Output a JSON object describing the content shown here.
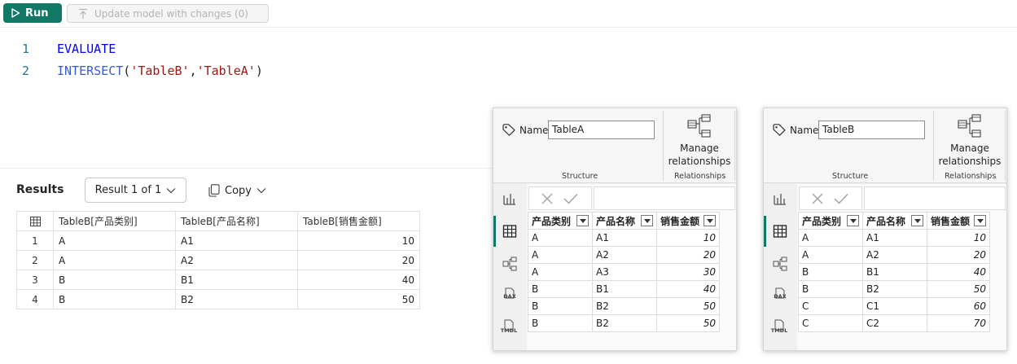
{
  "toolbar": {
    "run_label": "Run",
    "update_label": "Update model with changes (0)"
  },
  "editor": {
    "lines": [
      {
        "number": "1",
        "tokens": [
          {
            "t": "EVALUATE",
            "c": "kw"
          }
        ]
      },
      {
        "number": "2",
        "tokens": [
          {
            "t": "INTERSECT",
            "c": "fn"
          },
          {
            "t": "(",
            "c": "punc"
          },
          {
            "t": "'TableB'",
            "c": "str"
          },
          {
            "t": ",",
            "c": "punc"
          },
          {
            "t": "'TableA'",
            "c": "str"
          },
          {
            "t": ")",
            "c": "punc"
          }
        ]
      }
    ]
  },
  "results": {
    "title": "Results",
    "selector": "Result 1 of 1",
    "copy_label": "Copy",
    "columns": [
      "TableB[产品类别]",
      "TableB[产品名称]",
      "TableB[销售金额]"
    ],
    "rows": [
      {
        "index": "1",
        "cat": "A",
        "name": "A1",
        "amount": "10"
      },
      {
        "index": "2",
        "cat": "A",
        "name": "A2",
        "amount": "20"
      },
      {
        "index": "3",
        "cat": "B",
        "name": "B1",
        "amount": "40"
      },
      {
        "index": "4",
        "cat": "B",
        "name": "B2",
        "amount": "50"
      }
    ]
  },
  "panels": [
    {
      "name_label": "Name",
      "name_value": "TableA",
      "manage_label": "Manage relationships",
      "group_structure": "Structure",
      "group_relationships": "Relationships",
      "side_dax": "DAX",
      "side_tmdl": "TMDL",
      "columns": [
        "产品类别",
        "产品名称",
        "销售金额"
      ],
      "rows": [
        [
          "A",
          "A1",
          "10"
        ],
        [
          "A",
          "A2",
          "20"
        ],
        [
          "A",
          "A3",
          "30"
        ],
        [
          "B",
          "B1",
          "40"
        ],
        [
          "B",
          "B2",
          "50"
        ],
        [
          "B",
          "B2",
          "50"
        ]
      ]
    },
    {
      "name_label": "Name",
      "name_value": "TableB",
      "manage_label": "Manage relationships",
      "group_structure": "Structure",
      "group_relationships": "Relationships",
      "side_dax": "DAX",
      "side_tmdl": "TMDL",
      "columns": [
        "产品类别",
        "产品名称",
        "销售金额"
      ],
      "rows": [
        [
          "A",
          "A1",
          "10"
        ],
        [
          "A",
          "A2",
          "20"
        ],
        [
          "B",
          "B1",
          "40"
        ],
        [
          "B",
          "B2",
          "50"
        ],
        [
          "C",
          "C1",
          "60"
        ],
        [
          "C",
          "C2",
          "70"
        ]
      ]
    }
  ],
  "colors": {
    "accent": "#117865",
    "keyword": "#0000ff",
    "function": "#3a5bd0",
    "string": "#a31515"
  }
}
